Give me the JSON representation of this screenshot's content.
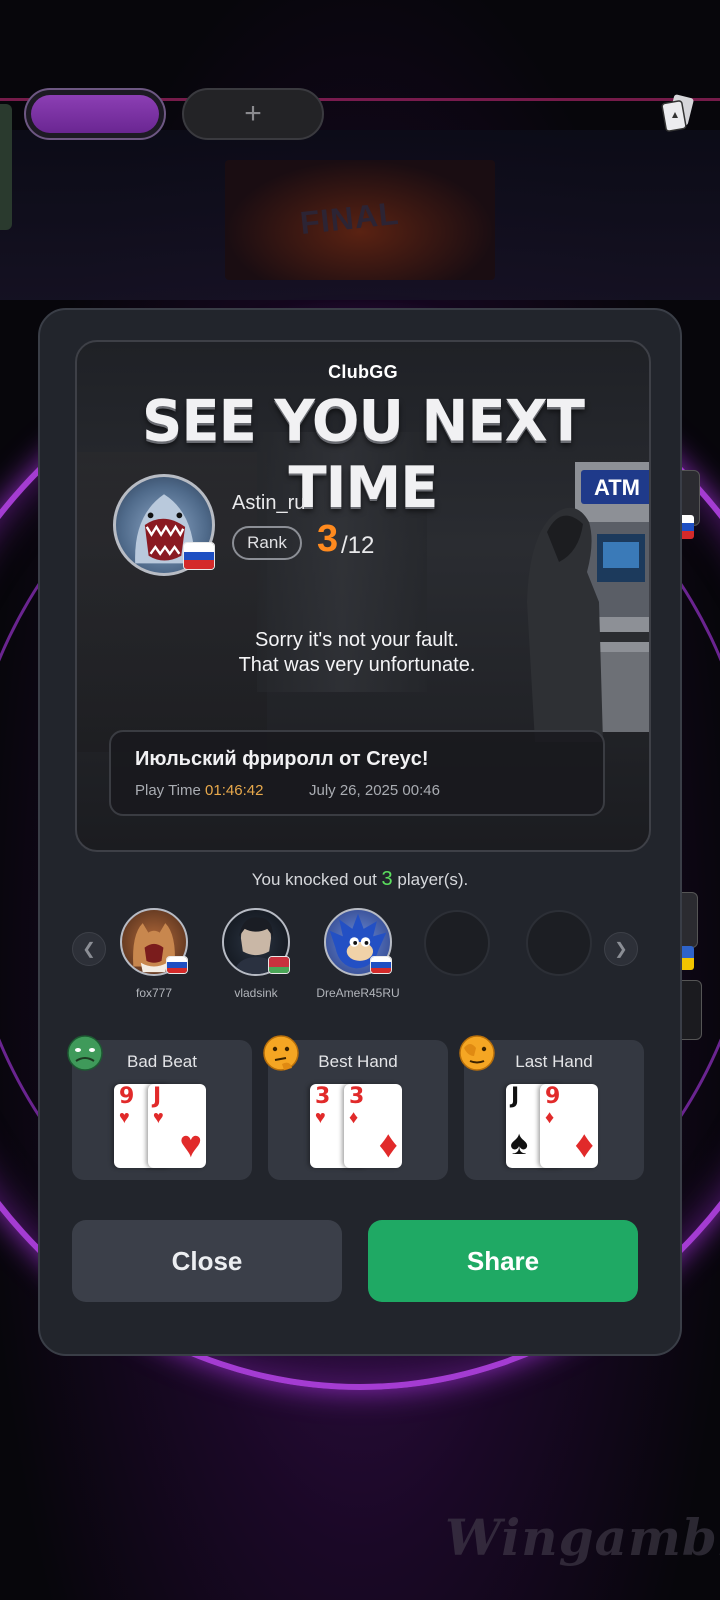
{
  "header": {
    "add_tab_label": "+"
  },
  "background": {
    "stage_text": "FINAL",
    "watermark": "Wingamble"
  },
  "modal": {
    "brand": "ClubGG",
    "title": "SEE YOU NEXT TIME",
    "player": {
      "username": "Astin_ru",
      "rank_label": "Rank",
      "rank": "3",
      "rank_total": "/12",
      "flag": "russia"
    },
    "message_line1": "Sorry it's not your fault.",
    "message_line2": "That was very unfortunate.",
    "atm_label": "ATM",
    "tournament": {
      "name": "Июльский фриролл от Creyc!",
      "play_time_label": "Play Time",
      "play_time": "01:46:42",
      "date": "July 26, 2025 00:46"
    },
    "knockout": {
      "prefix": "You knocked out",
      "count": "3",
      "suffix": "player(s)."
    },
    "knocked_players": [
      {
        "name": "fox777",
        "flag": "russia"
      },
      {
        "name": "vladsink",
        "flag": "belarus"
      },
      {
        "name": "DreAmeR45RU",
        "flag": "russia"
      }
    ],
    "hands": [
      {
        "title": "Bad Beat",
        "emoji": "sick-face-icon",
        "cards": [
          {
            "rank": "9",
            "suit": "♥"
          },
          {
            "rank": "J",
            "suit": "♥"
          }
        ]
      },
      {
        "title": "Best Hand",
        "emoji": "thinking-face-icon",
        "cards": [
          {
            "rank": "3",
            "suit": "♥"
          },
          {
            "rank": "3",
            "suit": "♦"
          }
        ]
      },
      {
        "title": "Last Hand",
        "emoji": "peeking-face-icon",
        "cards": [
          {
            "rank": "J",
            "suit": "♠"
          },
          {
            "rank": "9",
            "suit": "♦"
          }
        ]
      }
    ],
    "buttons": {
      "close": "Close",
      "share": "Share"
    }
  },
  "colors": {
    "accent_purple": "#8c3fb4",
    "rank_orange": "#ff8a1e",
    "share_green": "#1fa964",
    "knock_green": "#5be05e",
    "play_time_gold": "#e8a94c"
  }
}
